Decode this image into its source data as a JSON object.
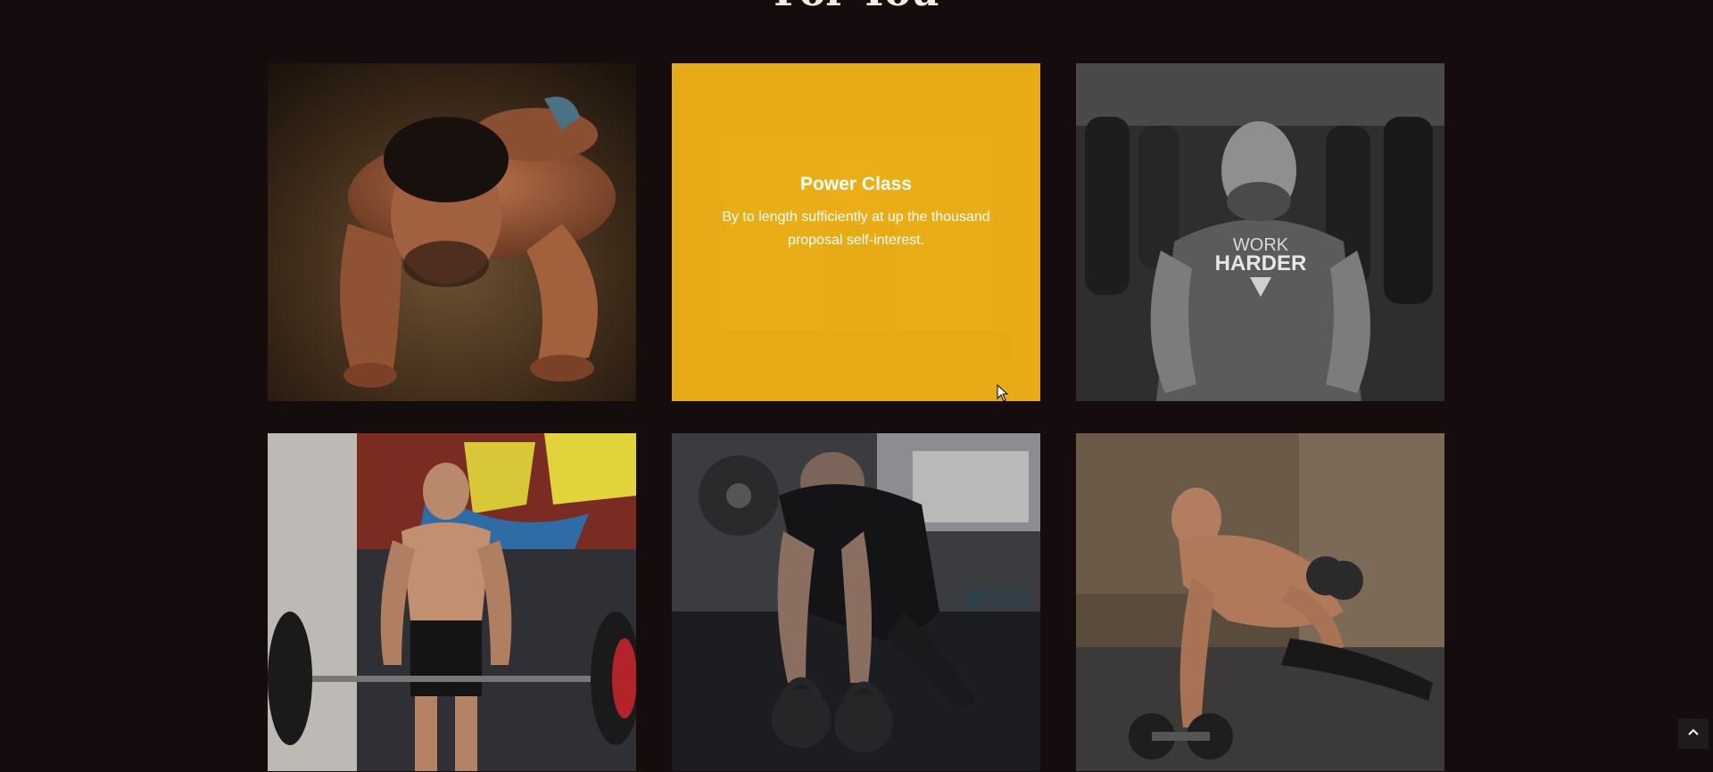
{
  "section": {
    "title": "For You"
  },
  "cards": [
    {
      "name": "pushup-man-photo"
    },
    {
      "name": "power-class",
      "title": "Power Class",
      "description": "By to length sufficiently at up the thousand proposal self-interest.",
      "accent": "#f2b414"
    },
    {
      "name": "work-harder-man-photo"
    },
    {
      "name": "barbell-deadlift-photo"
    },
    {
      "name": "kettlebell-pushup-photo"
    },
    {
      "name": "dumbbell-row-photo"
    }
  ],
  "ui": {
    "back_to_top_icon": "chevron-up-icon",
    "cursor_icon": "mouse-cursor-icon"
  }
}
